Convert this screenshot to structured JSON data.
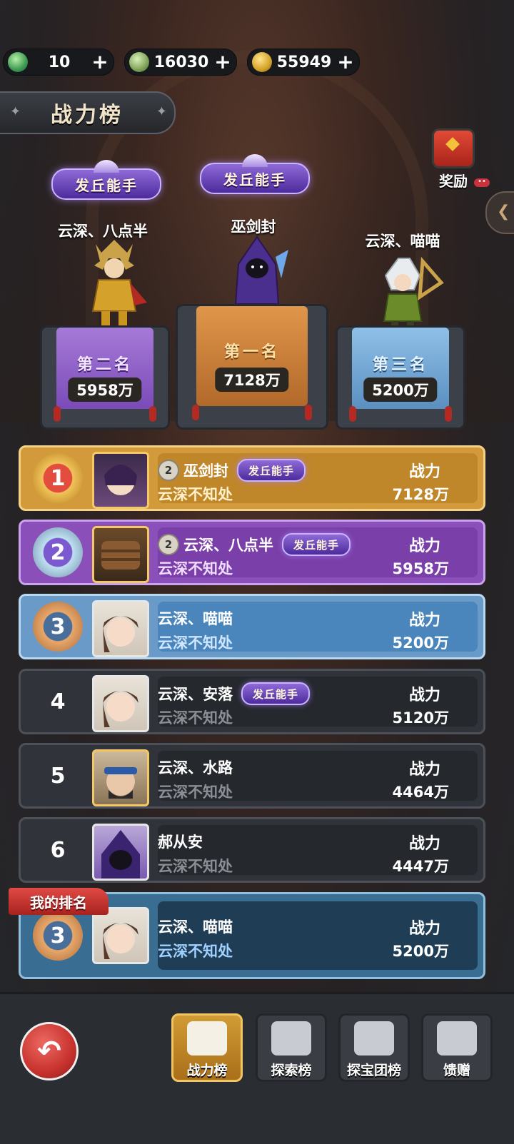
{
  "currencies": [
    {
      "icon": "jade-icon",
      "value": "10",
      "add": "+"
    },
    {
      "icon": "money-bag-icon",
      "value": "16030",
      "add": "+"
    },
    {
      "icon": "coin-icon",
      "value": "55949",
      "add": "+"
    }
  ],
  "title": "战力榜",
  "reward": {
    "label": "奖励",
    "dots": "••"
  },
  "podium": {
    "first": {
      "name": "巫剑封",
      "rank_label": "第一名",
      "power": "7128万",
      "badge": "发丘能手"
    },
    "second": {
      "name": "云深、八点半",
      "rank_label": "第二名",
      "power": "5958万",
      "badge": "发丘能手"
    },
    "third": {
      "name": "云深、喵喵",
      "rank_label": "第三名",
      "power": "5200万"
    }
  },
  "list": {
    "power_label": "战力",
    "rows": [
      {
        "rank": "1",
        "name": "巫剑封",
        "level": "2",
        "badge": "发丘能手",
        "guild": "云深不知处",
        "power": "7128万"
      },
      {
        "rank": "2",
        "name": "云深、八点半",
        "level": "2",
        "badge": "发丘能手",
        "guild": "云深不知处",
        "power": "5958万"
      },
      {
        "rank": "3",
        "name": "云深、喵喵",
        "guild": "云深不知处",
        "power": "5200万"
      },
      {
        "rank": "4",
        "name": "云深、安落",
        "badge": "发丘能手",
        "guild": "云深不知处",
        "power": "5120万"
      },
      {
        "rank": "5",
        "name": "云深、水路",
        "guild": "云深不知处",
        "power": "4464万"
      },
      {
        "rank": "6",
        "name": "郝从安",
        "guild": "云深不知处",
        "power": "4447万"
      }
    ],
    "my_rank": {
      "tag": "我的排名",
      "rank": "3",
      "name": "云深、喵喵",
      "guild": "云深不知处",
      "power": "5200万"
    }
  },
  "bottom_tabs": [
    {
      "label": "战力榜",
      "active": true
    },
    {
      "label": "探索榜"
    },
    {
      "label": "探宝团榜"
    },
    {
      "label": "馈赠"
    }
  ],
  "back_label": "↶"
}
